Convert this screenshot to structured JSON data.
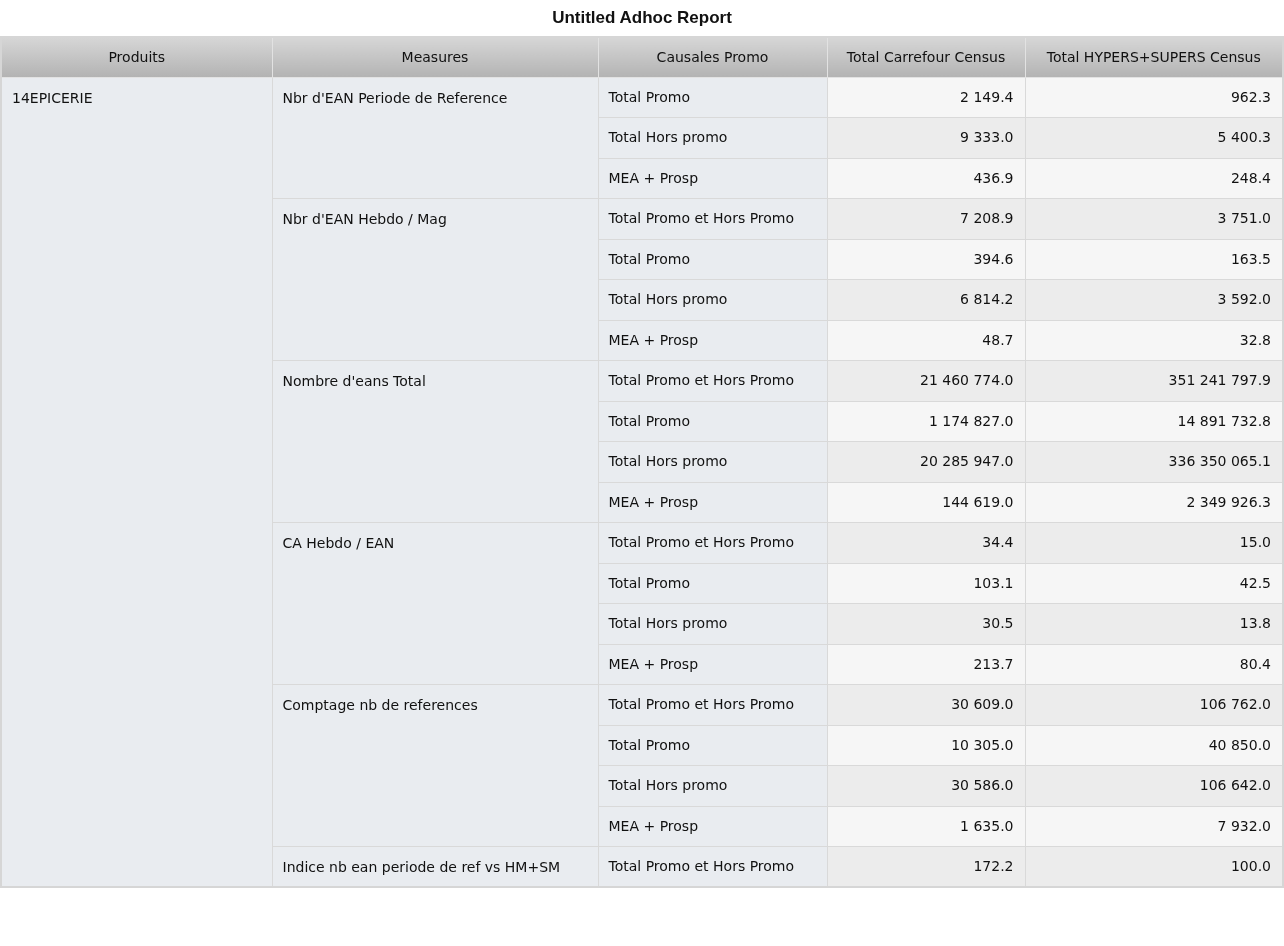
{
  "title": "Untitled Adhoc Report",
  "table": {
    "columns": [
      "Produits",
      "Measures",
      "Causales Promo",
      "Total Carrefour Census",
      "Total HYPERS+SUPERS Census"
    ],
    "product": "14EPICERIE",
    "measures": [
      {
        "name": "Nbr d'EAN Periode de Reference",
        "rows": [
          [
            "Total Promo",
            "2 149.4",
            "962.3"
          ],
          [
            "Total Hors promo",
            "9 333.0",
            "5 400.3"
          ],
          [
            "MEA + Prosp",
            "436.9",
            "248.4"
          ]
        ]
      },
      {
        "name": "Nbr d'EAN Hebdo / Mag",
        "rows": [
          [
            "Total Promo et Hors Promo",
            "7 208.9",
            "3 751.0"
          ],
          [
            "Total Promo",
            "394.6",
            "163.5"
          ],
          [
            "Total Hors promo",
            "6 814.2",
            "3 592.0"
          ],
          [
            "MEA + Prosp",
            "48.7",
            "32.8"
          ]
        ]
      },
      {
        "name": "Nombre d'eans Total",
        "rows": [
          [
            "Total Promo et Hors Promo",
            "21 460 774.0",
            "351 241 797.9"
          ],
          [
            "Total Promo",
            "1 174 827.0",
            "14 891 732.8"
          ],
          [
            "Total Hors promo",
            "20 285 947.0",
            "336 350 065.1"
          ],
          [
            "MEA + Prosp",
            "144 619.0",
            "2 349 926.3"
          ]
        ]
      },
      {
        "name": "CA Hebdo / EAN",
        "rows": [
          [
            "Total Promo et Hors Promo",
            "34.4",
            "15.0"
          ],
          [
            "Total Promo",
            "103.1",
            "42.5"
          ],
          [
            "Total Hors promo",
            "30.5",
            "13.8"
          ],
          [
            "MEA + Prosp",
            "213.7",
            "80.4"
          ]
        ]
      },
      {
        "name": "Comptage nb de references",
        "rows": [
          [
            "Total Promo et Hors Promo",
            "30 609.0",
            "106 762.0"
          ],
          [
            "Total Promo",
            "10 305.0",
            "40 850.0"
          ],
          [
            "Total Hors promo",
            "30 586.0",
            "106 642.0"
          ],
          [
            "MEA + Prosp",
            "1 635.0",
            "7 932.0"
          ]
        ]
      },
      {
        "name": "Indice nb ean periode de ref vs HM+SM",
        "rows": [
          [
            "Total Promo et Hors Promo",
            "172.2",
            "100.0"
          ]
        ]
      }
    ]
  }
}
